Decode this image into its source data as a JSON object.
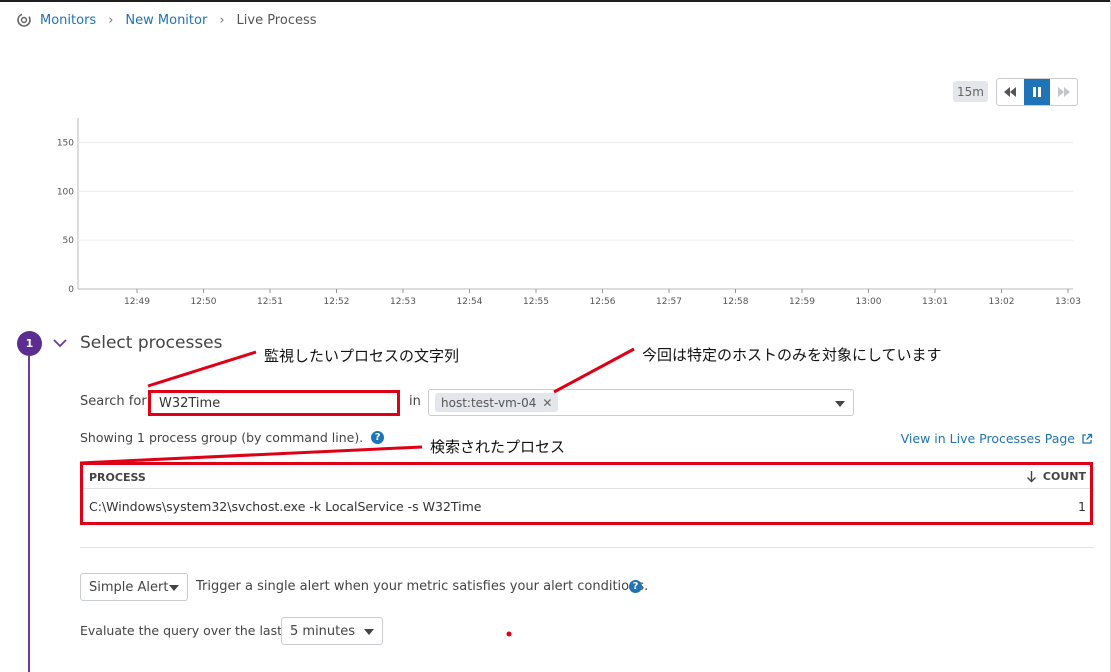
{
  "breadcrumb": {
    "items": [
      "Monitors",
      "New Monitor"
    ],
    "current": "Live Process"
  },
  "time": {
    "range_label": "15m"
  },
  "chart_data": {
    "type": "line",
    "x": [
      "12:49",
      "12:50",
      "12:51",
      "12:52",
      "12:53",
      "12:54",
      "12:55",
      "12:56",
      "12:57",
      "12:58",
      "12:59",
      "13:00",
      "13:01",
      "13:02",
      "13:03"
    ],
    "series": [],
    "yticks": [
      0,
      50,
      100,
      150
    ],
    "ylim": [
      0,
      175
    ],
    "grid": true
  },
  "step": {
    "number": "1",
    "title": "Select processes"
  },
  "search": {
    "label": "Search for",
    "value": "W32Time",
    "in_label": "in",
    "host_tag": "host:test-vm-04",
    "remove_glyph": "✕"
  },
  "summary": {
    "text": "Showing 1 process group (by command line).",
    "view_link": "View in Live Processes Page"
  },
  "table": {
    "columns": [
      "PROCESS",
      "COUNT"
    ],
    "rows": [
      {
        "process": "C:\\Windows\\system32\\svchost.exe -k LocalService -s W32Time",
        "count": "1"
      }
    ]
  },
  "alert": {
    "mode": "Simple Alert",
    "description": "Trigger a single alert when your metric satisfies your alert conditions."
  },
  "evaluate": {
    "label": "Evaluate the query over the last",
    "window": "5 minutes"
  },
  "annotations": {
    "search_note": "監視したいプロセスの文字列",
    "host_note": "今回は特定のホストのみを対象にしています",
    "result_note": "検索されたプロセス"
  },
  "colors": {
    "accent": "#1f73b7",
    "step": "#5c2d91",
    "annotation": "#e00016"
  }
}
